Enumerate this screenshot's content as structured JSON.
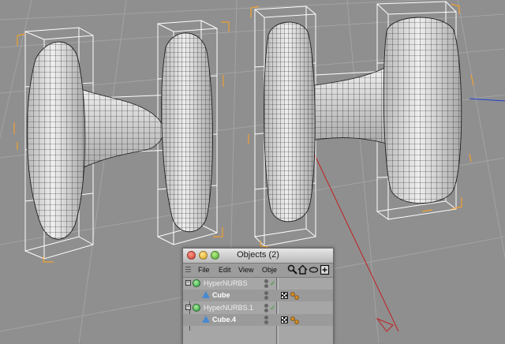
{
  "window": {
    "title": "Objects (2)",
    "menu": {
      "file": "File",
      "edit": "Edit",
      "view": "View",
      "objects": "Obje"
    },
    "toolbar_icons": [
      "search-icon",
      "home-icon",
      "eye-icon",
      "new-window-icon"
    ]
  },
  "objects": [
    {
      "name": "HyperNURBS",
      "type": "hypernurbs-icon",
      "expanded": true,
      "enabled": true
    },
    {
      "name": "Cube",
      "type": "cube-icon",
      "tags": [
        "texture-tag-icon",
        "phong-tag-icon"
      ]
    },
    {
      "name": "HyperNURBS.1",
      "type": "hypernurbs-icon",
      "expanded": true,
      "enabled": true
    },
    {
      "name": "Cube.4",
      "type": "cube-icon",
      "tags": [
        "texture-tag-icon",
        "phong-tag-icon"
      ]
    }
  ],
  "colors": {
    "viewport_bg": "#8f8f8f",
    "grid": "#a3a3a3",
    "mesh_fill": "#d8d8d8",
    "mesh_wire": "#1e1e1e",
    "cage": "#ffffff",
    "bbox_corners": "#f0a030",
    "axis_x": "#d02020",
    "axis_y": "#20b020",
    "axis_z": "#2040d0"
  }
}
